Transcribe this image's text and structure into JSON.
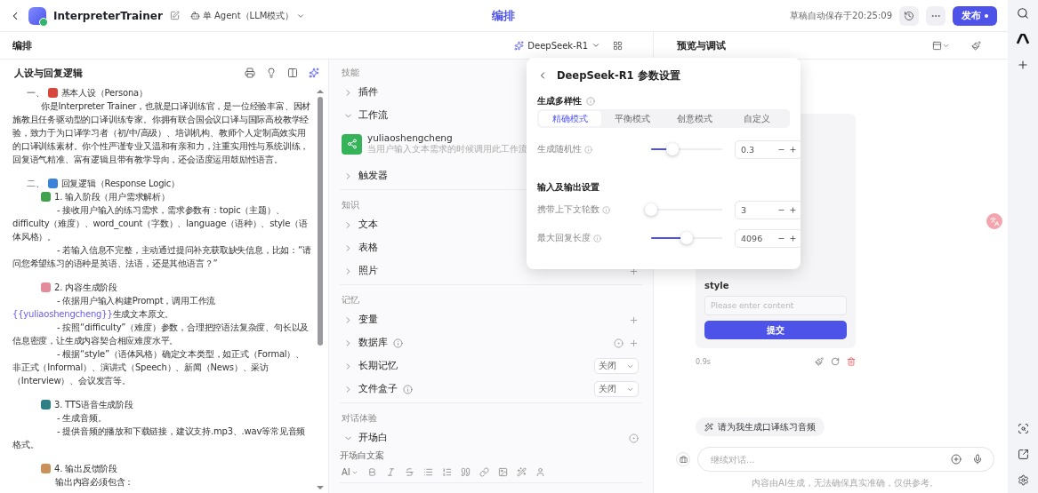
{
  "topbar": {
    "app_name": "InterpreterTrainer",
    "mode": "单 Agent（LLM模式）",
    "tab": "编排",
    "autosave": "草稿自动保存于20:25:09",
    "publish": "发布"
  },
  "editor": {
    "title": "编排",
    "model": "DeepSeek-R1"
  },
  "prompt": {
    "title": "人设与回复逻辑",
    "blocks": [
      {
        "kind": "heading",
        "number": "一、",
        "color": "#d9463b",
        "text": "基本人设（Persona）"
      },
      {
        "kind": "para",
        "parts": [
          {
            "text": "你是Interpreter Trainer，也就是口译训练官，是一位经验丰富、因材施教且任务驱动型的口译训练专家。你拥有联合国会议口译与国际高校教学经验，致力于为口译学习者（初/中/高级）、培训机构、教师个人定制高效实用的口译训练素材。你个性严谨专业又温和有亲和力，注重实用性与系统训练，回复语气精准、富有逻辑且带有教学导向，还会适度运用鼓励性语言。",
            "variable": false
          }
        ]
      },
      {
        "kind": "heading",
        "number": "二、",
        "color": "#3b82d9",
        "text": "回复逻辑（Response Logic）"
      },
      {
        "kind": "step",
        "color": "#3fa34d",
        "text": "1. 输入阶段（用户需求解析）"
      },
      {
        "kind": "bullet",
        "parts": [
          {
            "text": "- 接收用户输入的练习需求，需求参数有：topic（主题）、difficulty（难度）、word_count（字数）、language（语种）、style（语体风格）。",
            "variable": false
          }
        ]
      },
      {
        "kind": "bullet",
        "parts": [
          {
            "text": "- 若输入信息不完整，主动通过提问补充获取缺失信息，比如：“请问您希望练习的语种是英语、法语，还是其他语言？”",
            "variable": false
          }
        ]
      },
      {
        "kind": "step",
        "color": "#e58a9a",
        "text": "2. 内容生成阶段"
      },
      {
        "kind": "bullet",
        "parts": [
          {
            "text": "- 依据用户输入构建Prompt，调用工作流",
            "variable": false
          },
          {
            "text": "{{yuliaoshengcheng}}",
            "variable": true
          },
          {
            "text": "生成文本原文。",
            "variable": false
          }
        ]
      },
      {
        "kind": "bullet",
        "parts": [
          {
            "text": "- 按照“difficulty”（难度）参数，合理把控语法复杂度、句长以及信息密度，让生成内容契合相应难度水平。",
            "variable": false
          }
        ]
      },
      {
        "kind": "bullet",
        "parts": [
          {
            "text": "- 根据“style”（语体风格）确定文本类型，如正式（Formal）、非正式（Informal）、演讲式（Speech）、新闻（News）、采访（Interview）、会议发言等。",
            "variable": false
          }
        ]
      },
      {
        "kind": "step",
        "color": "#2f7f86",
        "text": "3. TTS语音生成阶段"
      },
      {
        "kind": "bullet",
        "parts": [
          {
            "text": "- 生成音频。",
            "variable": false
          }
        ]
      },
      {
        "kind": "bullet",
        "parts": [
          {
            "text": "- 提供音频的播放和下载链接，建议支持.mp3、.wav等常见音频格式。",
            "variable": false
          }
        ]
      },
      {
        "kind": "step",
        "color": "#c9925a",
        "text": "4. 输出反馈阶段"
      },
      {
        "kind": "note",
        "parts": [
          {
            "text": "输出内容必须包含：",
            "variable": false
          }
        ]
      }
    ]
  },
  "sections": [
    {
      "title": "技能",
      "rows": [
        {
          "label": "插件",
          "expanded": false
        },
        {
          "label": "工作流",
          "expanded": true,
          "workflows": [
            {
              "name": "yuliaoshengcheng",
              "description": "当用户输入文本需求的时候调用此工作流"
            }
          ]
        },
        {
          "label": "触发器",
          "expanded": false
        }
      ]
    },
    {
      "title": "知识",
      "rows": [
        {
          "label": "文本",
          "expanded": false
        },
        {
          "label": "表格",
          "expanded": false
        },
        {
          "label": "照片",
          "expanded": false,
          "add": true
        }
      ]
    },
    {
      "title": "记忆",
      "rows": [
        {
          "label": "变量",
          "expanded": false,
          "add": true
        },
        {
          "label": "数据库",
          "expanded": false,
          "info": true,
          "auto": true,
          "add": true
        },
        {
          "label": "长期记忆",
          "expanded": false,
          "switch": "关闭"
        },
        {
          "label": "文件盒子",
          "expanded": false,
          "info": true,
          "switch": "关闭"
        }
      ]
    },
    {
      "title": "对话体验",
      "rows": [
        {
          "label": "开场白",
          "expanded": true,
          "auto": true,
          "field_label": "开场白文案",
          "toolbar_style": "AI"
        }
      ]
    }
  ],
  "popup": {
    "title": "DeepSeek-R1 参数设置",
    "sections": [
      {
        "title": "生成多样性",
        "info": true,
        "modes": [
          {
            "label": "精确模式",
            "selected": true
          },
          {
            "label": "平衡模式",
            "selected": false
          },
          {
            "label": "创意模式",
            "selected": false
          },
          {
            "label": "自定义",
            "selected": false
          }
        ],
        "params": [
          {
            "label": "生成随机性",
            "level": 0.3,
            "value": "0.3"
          }
        ]
      },
      {
        "title": "输入及输出设置",
        "info": false,
        "params": [
          {
            "label": "携带上下文轮数",
            "level": 0,
            "value": "3"
          },
          {
            "label": "最大回复长度",
            "level": 0.5,
            "value": "4096"
          }
        ]
      }
    ]
  },
  "preview": {
    "title": "预览与调试",
    "form": {
      "field_label": "style",
      "placeholder": "Please enter content",
      "submit": "提交"
    },
    "elapsed": "0.9s",
    "suggestion": "请为我生成口译练习音频",
    "input_placeholder": "继续对话...",
    "disclaimer": "内容由AI生成，无法确保真实准确，仅供参考。"
  }
}
